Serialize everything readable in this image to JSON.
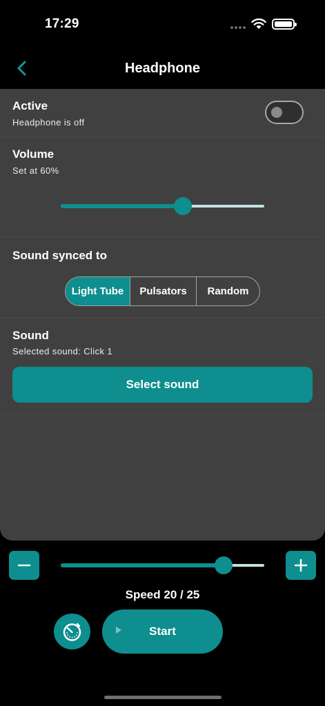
{
  "status_bar": {
    "time": "17:29"
  },
  "nav": {
    "title": "Headphone",
    "back_icon": "chevron-left-icon"
  },
  "active": {
    "title": "Active",
    "subtitle": "Headphone is off",
    "enabled": false
  },
  "volume": {
    "title": "Volume",
    "subtitle": "Set at 60%",
    "value_percent": 60
  },
  "sync": {
    "title": "Sound synced to",
    "options": [
      "Light Tube",
      "Pulsators",
      "Random"
    ],
    "selected_index": 0
  },
  "sound": {
    "title": "Sound",
    "subtitle": "Selected sound: Click 1",
    "button_label": "Select sound"
  },
  "speed": {
    "label": "Speed 20 / 25",
    "value": 20,
    "max": 25
  },
  "controls": {
    "start_label": "Start",
    "decrease_icon": "minus-icon",
    "increase_icon": "plus-icon",
    "timer_icon": "timer-icon",
    "play_icon": "play-icon"
  },
  "colors": {
    "accent": "#0e8e8e",
    "card": "#404040",
    "background": "#000000"
  }
}
